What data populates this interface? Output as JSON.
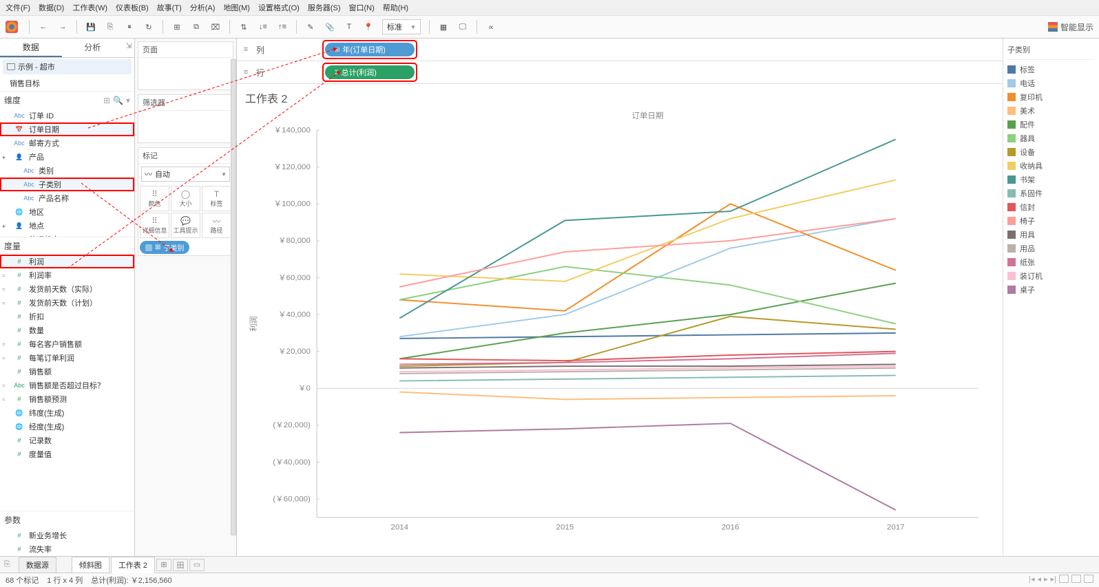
{
  "menu": [
    "文件(F)",
    "数据(D)",
    "工作表(W)",
    "仪表板(B)",
    "故事(T)",
    "分析(A)",
    "地图(M)",
    "设置格式(O)",
    "服务器(S)",
    "窗口(N)",
    "帮助(H)"
  ],
  "toolbar": {
    "std": "标准",
    "showme": "智能显示"
  },
  "leftTabs": {
    "data": "数据",
    "analysis": "分析"
  },
  "datasources": {
    "ds1": "示例 - 超市",
    "ds2": "销售目标"
  },
  "section": {
    "dimensions": "维度",
    "measures": "度量",
    "params": "参数"
  },
  "dims": [
    {
      "ic": "Abc",
      "n": "订单 ID"
    },
    {
      "ic": "📅",
      "n": "订单日期",
      "hl": true
    },
    {
      "ic": "Abc",
      "n": "邮寄方式"
    },
    {
      "ic": "👤",
      "n": "产品",
      "grp": true
    },
    {
      "ic": "Abc",
      "n": "类别",
      "ind": true
    },
    {
      "ic": "Abc",
      "n": "子类别",
      "ind": true,
      "hl": true
    },
    {
      "ic": "Abc",
      "n": "产品名称",
      "ind": true
    },
    {
      "ic": "🌐",
      "n": "地区"
    },
    {
      "ic": "👤",
      "n": "地点",
      "grp": true
    },
    {
      "ic": "Abc",
      "n": "装运状态",
      "calc": true
    }
  ],
  "meas": [
    {
      "ic": "#",
      "n": "利润",
      "hl": true
    },
    {
      "ic": "#",
      "n": "利润率",
      "calc": true
    },
    {
      "ic": "#",
      "n": "发货前天数（实际）",
      "calc": true
    },
    {
      "ic": "#",
      "n": "发货前天数（计划）",
      "calc": true
    },
    {
      "ic": "#",
      "n": "折扣"
    },
    {
      "ic": "#",
      "n": "数量"
    },
    {
      "ic": "#",
      "n": "每名客户销售额",
      "calc": true
    },
    {
      "ic": "#",
      "n": "每笔订单利润",
      "calc": true
    },
    {
      "ic": "#",
      "n": "销售额"
    },
    {
      "ic": "Abc",
      "n": "销售额是否超过目标？",
      "calc": true
    },
    {
      "ic": "#",
      "n": "销售额预测",
      "calc": true
    },
    {
      "ic": "🌐",
      "n": "纬度(生成)"
    },
    {
      "ic": "🌐",
      "n": "经度(生成)"
    },
    {
      "ic": "#",
      "n": "记录数"
    },
    {
      "ic": "#",
      "n": "度量值"
    }
  ],
  "params": [
    {
      "ic": "#",
      "n": "新业务增长"
    },
    {
      "ic": "#",
      "n": "流失率"
    }
  ],
  "cards": {
    "pages": "页面",
    "filters": "筛选器",
    "marks": "标记",
    "auto": "自动",
    "mcells": [
      [
        "⠿",
        "颜色"
      ],
      [
        "◯",
        "大小"
      ],
      [
        "T",
        "标签"
      ],
      [
        "⠿",
        "详细信息"
      ],
      [
        "💬",
        "工具提示"
      ],
      [
        "〰",
        "路径"
      ]
    ],
    "colorPill": "子类别"
  },
  "shelves": {
    "cols": "列",
    "rows": "行",
    "colPill": "年(订单日期)",
    "rowPill": "总计(利润)"
  },
  "viz": {
    "title": "工作表 2",
    "xhead": "订单日期"
  },
  "legend": {
    "title": "子类别",
    "items": [
      [
        "标签",
        "#4e79a7"
      ],
      [
        "电话",
        "#a0cbe8"
      ],
      [
        "复印机",
        "#f28e2b"
      ],
      [
        "美术",
        "#ffbe7d"
      ],
      [
        "配件",
        "#59a14f"
      ],
      [
        "器具",
        "#8cd17d"
      ],
      [
        "设备",
        "#b6992d"
      ],
      [
        "收纳具",
        "#f1ce63"
      ],
      [
        "书架",
        "#499894"
      ],
      [
        "系固件",
        "#86bcb6"
      ],
      [
        "信封",
        "#e15759"
      ],
      [
        "椅子",
        "#ff9d9a"
      ],
      [
        "用具",
        "#79706e"
      ],
      [
        "用品",
        "#bab0ac"
      ],
      [
        "纸张",
        "#d37295"
      ],
      [
        "装订机",
        "#fabfd2"
      ],
      [
        "桌子",
        "#b07aa1"
      ]
    ]
  },
  "bottomTabs": {
    "dsrc": "数据源",
    "t1": "倾斜图",
    "t2": "工作表 2"
  },
  "status": {
    "marks": "68 个标记",
    "rc": "1 行 x 4 列",
    "sum": "总计(利润): ￥2,156,560"
  },
  "chart_data": {
    "type": "line",
    "title": "工作表 2",
    "ylabel": "利润",
    "xlabel": "订单日期",
    "categories": [
      "2014",
      "2015",
      "2016",
      "2017"
    ],
    "ylim": [
      -70000,
      140000
    ],
    "yticks": [
      -60000,
      -40000,
      -20000,
      0,
      20000,
      40000,
      60000,
      80000,
      100000,
      120000,
      140000
    ],
    "ytick_labels": [
      "(￥60,000)",
      "(￥40,000)",
      "(￥20,000)",
      "￥0",
      "￥20,000",
      "￥40,000",
      "￥60,000",
      "￥80,000",
      "￥100,000",
      "￥120,000",
      "￥140,000"
    ],
    "series": [
      {
        "name": "标签",
        "color": "#4e79a7",
        "values": [
          27000,
          28000,
          29000,
          30000
        ]
      },
      {
        "name": "电话",
        "color": "#a0cbe8",
        "values": [
          28000,
          40000,
          76000,
          92000
        ]
      },
      {
        "name": "复印机",
        "color": "#f28e2b",
        "values": [
          48000,
          42000,
          100000,
          64000
        ]
      },
      {
        "name": "美术",
        "color": "#ffbe7d",
        "values": [
          -2000,
          -6000,
          -5000,
          -4000
        ]
      },
      {
        "name": "配件",
        "color": "#59a14f",
        "values": [
          16000,
          30000,
          40000,
          57000
        ]
      },
      {
        "name": "器具",
        "color": "#8cd17d",
        "values": [
          48000,
          66000,
          56000,
          35000
        ]
      },
      {
        "name": "设备",
        "color": "#b6992d",
        "values": [
          12000,
          14000,
          39000,
          32000
        ]
      },
      {
        "name": "收纳具",
        "color": "#f1ce63",
        "values": [
          62000,
          58000,
          92000,
          113000
        ]
      },
      {
        "name": "书架",
        "color": "#499894",
        "values": [
          38000,
          91000,
          96000,
          135000
        ]
      },
      {
        "name": "系固件",
        "color": "#86bcb6",
        "values": [
          4000,
          5000,
          6000,
          7000
        ]
      },
      {
        "name": "信封",
        "color": "#e15759",
        "values": [
          16000,
          15000,
          18000,
          20000
        ]
      },
      {
        "name": "椅子",
        "color": "#ff9d9a",
        "values": [
          55000,
          74000,
          80000,
          92000
        ]
      },
      {
        "name": "用具",
        "color": "#79706e",
        "values": [
          11000,
          12000,
          12000,
          13000
        ]
      },
      {
        "name": "用品",
        "color": "#bab0ac",
        "values": [
          8000,
          9000,
          10000,
          11000
        ]
      },
      {
        "name": "纸张",
        "color": "#d37295",
        "values": [
          13000,
          14000,
          16000,
          19000
        ]
      },
      {
        "name": "装订机",
        "color": "#fabfd2",
        "values": [
          9000,
          10000,
          11000,
          12000
        ]
      },
      {
        "name": "桌子",
        "color": "#b07aa1",
        "values": [
          -24000,
          -22000,
          -19000,
          -66000
        ]
      }
    ]
  }
}
